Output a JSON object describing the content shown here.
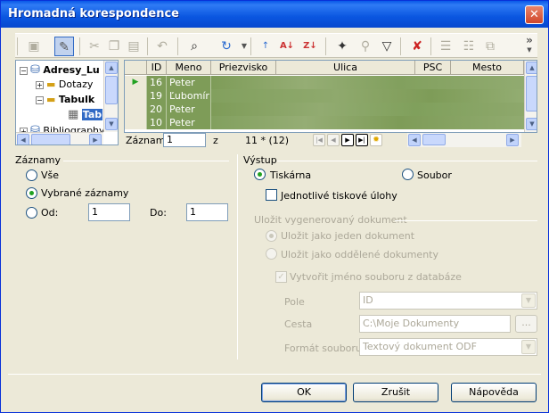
{
  "window": {
    "title": "Hromadná korespondence",
    "close_symbol": "✕"
  },
  "toolbar": {
    "icons": [
      "save-icon",
      "edit-icon",
      "cut-icon",
      "copy-icon",
      "paste-icon",
      "undo-icon",
      "find-icon",
      "refresh-icon",
      "sort-ascending-icon",
      "sort-az-icon",
      "sort-za-icon",
      "autofilter-icon",
      "standard-filter-icon",
      "apply-filter-icon",
      "remove-filter-icon",
      "data-to-text-icon",
      "data-to-fields-icon",
      "mail-merge-icon"
    ],
    "overflow": "»"
  },
  "tree": {
    "items": [
      {
        "label": "Adresy_Lu",
        "bold": true
      },
      {
        "label": "Dotazy",
        "bold": false
      },
      {
        "label": "Tabulk",
        "bold": true
      },
      {
        "label": "Tab",
        "bold": true
      },
      {
        "label": "Bibliography",
        "bold": false
      }
    ]
  },
  "grid": {
    "columns": [
      "ID",
      "Meno",
      "Priezvisko",
      "Ulica",
      "PSC",
      "Mesto"
    ],
    "rows": [
      {
        "id": "16",
        "meno": "Peter"
      },
      {
        "id": "19",
        "meno": "Ľubomír"
      },
      {
        "id": "20",
        "meno": "Peter"
      },
      {
        "id": "10",
        "meno": "Peter"
      }
    ],
    "record_label": "Záznam",
    "record_value": "1",
    "record_of": "z",
    "record_count": "11 * (12)"
  },
  "zaznamy": {
    "label": "Záznamy",
    "options": {
      "all": "Vše",
      "selected": "Vybrané záznamy",
      "from": "Od:",
      "to": "Do:"
    },
    "from_value": "1",
    "to_value": "1"
  },
  "vystup": {
    "label": "Výstup",
    "printer": "Tiskárna",
    "file": "Soubor",
    "individual_jobs": "Jednotlivé tiskové úlohy",
    "save_label": "Uložit vygenerovaný dokument",
    "single_doc": "Uložit jako jeden dokument",
    "separate_docs": "Uložit jako oddělené dokumenty",
    "filename_from_db": "Vytvořit jméno souboru z databáze",
    "field_label": "Pole",
    "field_value": "ID",
    "path_label": "Cesta",
    "path_value": "C:\\Moje Dokumenty",
    "browse": "...",
    "format_label": "Formát souboru",
    "format_value": "Textový dokument ODF"
  },
  "buttons": {
    "ok": "OK",
    "cancel": "Zrušit",
    "help": "Nápověda"
  }
}
